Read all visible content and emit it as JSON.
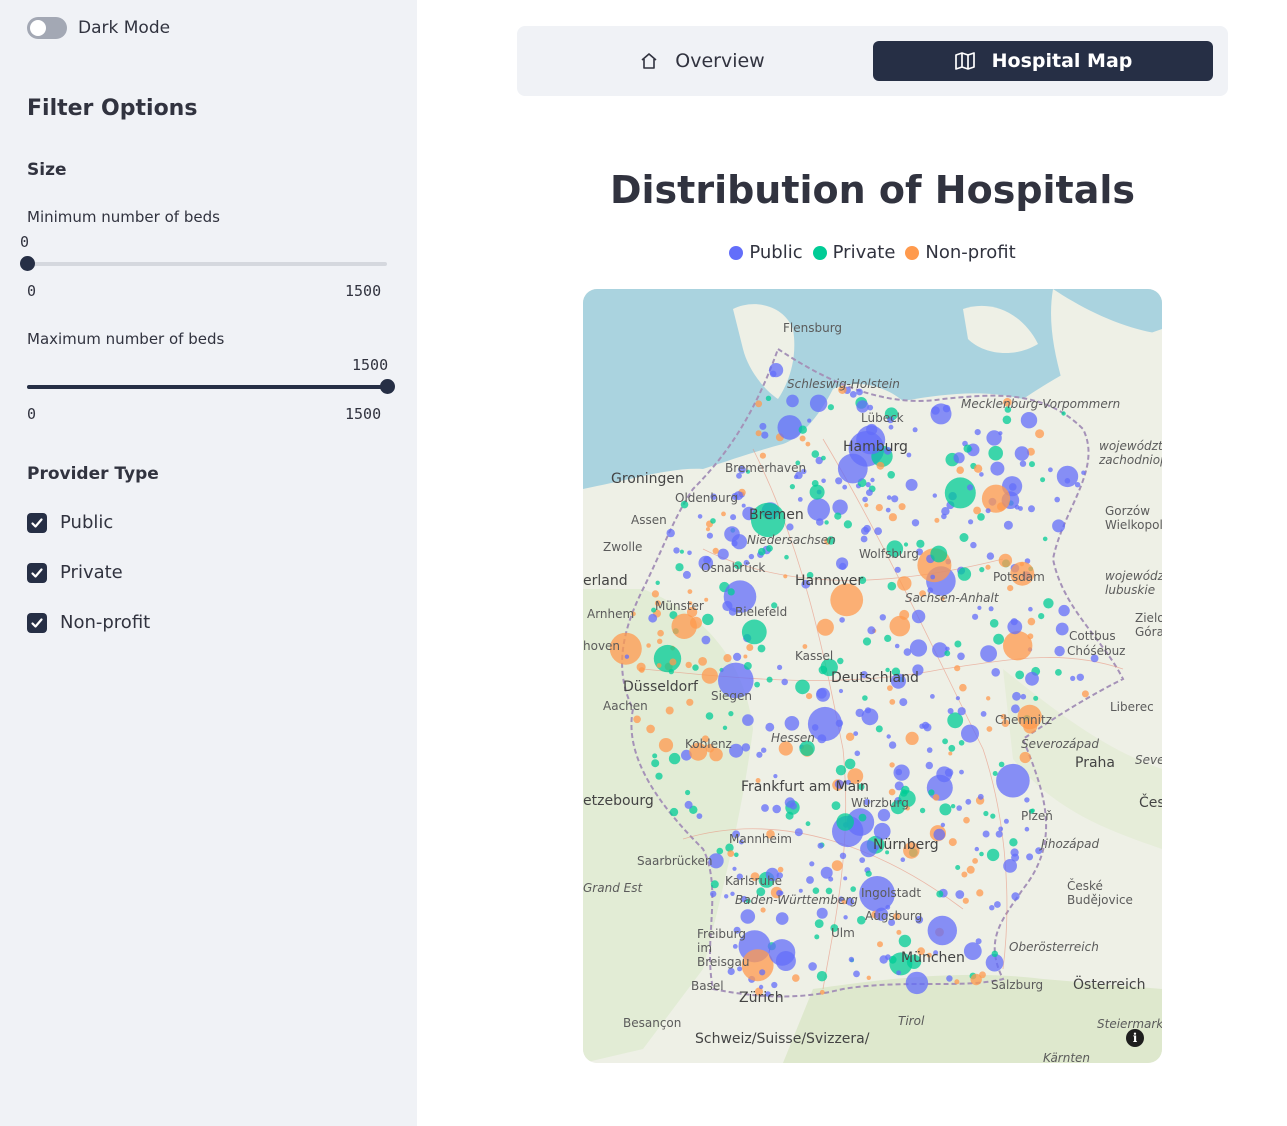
{
  "sidebar": {
    "dark_mode_label": "Dark Mode",
    "dark_mode_on": false,
    "filter_title": "Filter Options",
    "size_title": "Size",
    "min_slider": {
      "label": "Minimum number of beds",
      "value": "0",
      "min": "0",
      "max": "1500"
    },
    "max_slider": {
      "label": "Maximum number of beds",
      "value": "1500",
      "min": "0",
      "max": "1500"
    },
    "provider_title": "Provider Type",
    "providers": [
      {
        "label": "Public",
        "checked": true
      },
      {
        "label": "Private",
        "checked": true
      },
      {
        "label": "Non-profit",
        "checked": true
      }
    ]
  },
  "tabs": [
    {
      "label": "Overview",
      "icon": "home-icon",
      "active": false
    },
    {
      "label": "Hospital Map",
      "icon": "map-icon",
      "active": true
    }
  ],
  "chart": {
    "title": "Distribution of Hospitals",
    "legend": [
      {
        "label": "Public",
        "color": "#636efa"
      },
      {
        "label": "Private",
        "color": "#00cc96"
      },
      {
        "label": "Non-profit",
        "color": "#ff9a4d"
      }
    ]
  },
  "map_labels": [
    "Flensburg",
    "Schleswig-Holstein",
    "Lübeck",
    "Mecklenburg-Vorpommern",
    "Hamburg",
    "Bremerhaven",
    "Groningen",
    "Oldenburg",
    "Bremen",
    "Assen",
    "Zwolle",
    "Niedersachsen",
    "Wolfsburg",
    "Hannover",
    "Osnabrück",
    "erland",
    "Münster",
    "Bielefeld",
    "Arnhem",
    "hoven",
    "Potsdam",
    "Cottbus",
    "Chóśebuz",
    "Deutschland",
    "Kassel",
    "Siegen",
    "Düsseldorf",
    "Aachen",
    "Koblenz",
    "Hessen",
    "Chemnitz",
    "Liberec",
    "Praha",
    "Severozápad",
    "Frankfurt am Main",
    "Würzburg",
    "etzebourg",
    "Mannheim",
    "Nürnberg",
    "Plzeň",
    "Jihozápad",
    "Saarbrücken",
    "Karlsruhe",
    "Baden-Württemberg",
    "Ingolstadt",
    "Augsburg",
    "Grand Est",
    "Freiburg im Breisgau",
    "Ulm",
    "München",
    "Oberösterreich",
    "České Budějovice",
    "Basel",
    "Zürich",
    "Salzburg",
    "Österreich",
    "Besançon",
    "Tirol",
    "Schweiz/Suisse/Svizzera/",
    "Steiermark",
    "Gorzów Wielkopolski",
    "województwo zachodniopomorskie",
    "województwo lubuskie",
    "Zielona Góra",
    "Sachsen-Anhalt",
    "Severovýchod",
    "Česko",
    "Kärnten"
  ]
}
